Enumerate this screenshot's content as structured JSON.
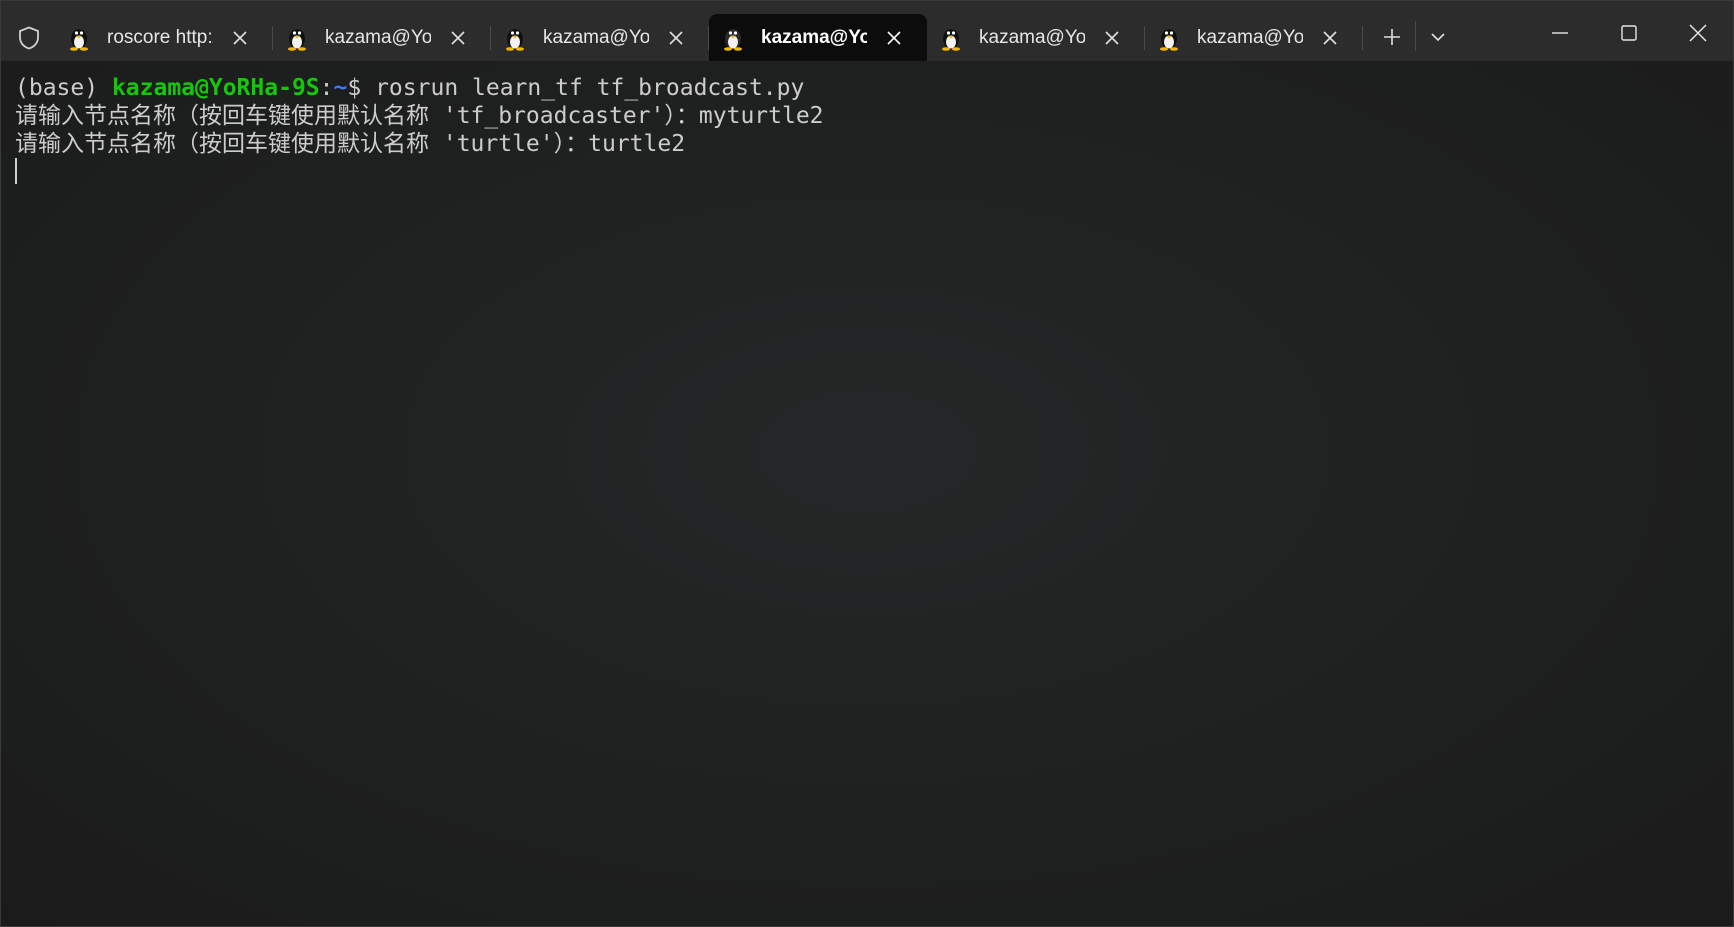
{
  "window": {
    "tabs": [
      {
        "title": "roscore http:/",
        "icon": "tux-icon",
        "active": false
      },
      {
        "title": "kazama@YoR",
        "icon": "tux-icon",
        "active": false
      },
      {
        "title": "kazama@YoR",
        "icon": "tux-icon",
        "active": false
      },
      {
        "title": "kazama@YoR",
        "icon": "tux-icon",
        "active": true
      },
      {
        "title": "kazama@YoR",
        "icon": "tux-icon",
        "active": false
      },
      {
        "title": "kazama@YoR",
        "icon": "tux-icon",
        "active": false
      }
    ],
    "controls": [
      "minimize-icon",
      "maximize-icon",
      "close-icon"
    ]
  },
  "terminal": {
    "prompt": {
      "env": "(base) ",
      "user_host": "kazama@YoRHa-9S",
      "colon": ":",
      "path": "~",
      "dollar": "$ ",
      "command": "rosrun learn_tf tf_broadcast.py"
    },
    "output_lines": [
      "请输入节点名称（按回车键使用默认名称 'tf_broadcaster'）：myturtle2",
      "请输入节点名称（按回车键使用默认名称 'turtle'）：turtle2"
    ]
  },
  "colors": {
    "prompt_user": "#16c60c",
    "prompt_path": "#3b78ff",
    "text": "#cccccc",
    "background": "#1e1f1f"
  }
}
